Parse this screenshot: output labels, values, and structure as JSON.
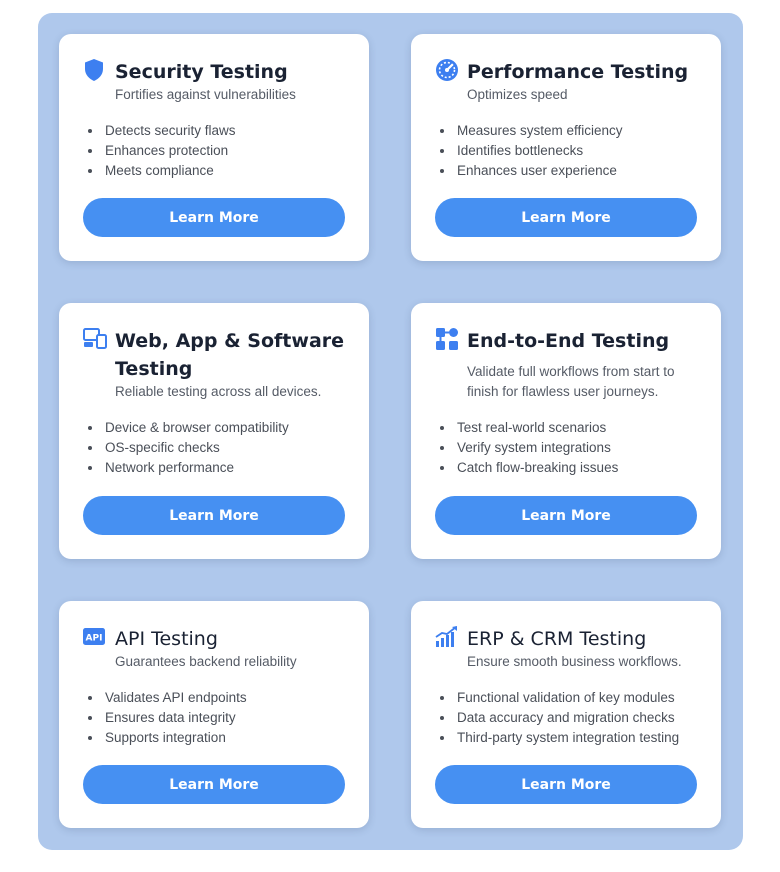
{
  "cards": [
    {
      "title": "Security Testing",
      "title_line2": "",
      "subtitle": "Fortifies against vulnerabilities",
      "icon": "shield-icon",
      "bullets": [
        "Detects security flaws",
        "Enhances protection",
        "Meets compliance"
      ],
      "button": "Learn More"
    },
    {
      "title": "Performance Testing",
      "title_line2": "",
      "subtitle": "Optimizes speed",
      "icon": "speedometer-icon",
      "bullets": [
        "Measures system efficiency",
        "Identifies bottlenecks",
        "Enhances user experience"
      ],
      "button": "Learn More"
    },
    {
      "title": "Web, App & Software",
      "title_line2": "Testing",
      "subtitle": "Reliable testing across all devices.",
      "icon": "devices-icon",
      "bullets": [
        "Device & browser compatibility",
        "OS-specific checks",
        "Network performance"
      ],
      "button": "Learn More"
    },
    {
      "title": "End-to-End Testing",
      "title_line2": "",
      "subtitle": "Validate full workflows from start to",
      "subtitle_line2": "finish for flawless user journeys.",
      "icon": "workflow-icon",
      "bullets": [
        "Test real-world scenarios",
        "Verify system integrations",
        "Catch flow-breaking issues"
      ],
      "button": "Learn More"
    },
    {
      "title": "API Testing",
      "title_line2": "",
      "subtitle": "Guarantees backend reliability",
      "icon": "api-icon",
      "icon_text": "API",
      "bullets": [
        "Validates API endpoints",
        "Ensures data integrity",
        "Supports integration"
      ],
      "button": "Learn More"
    },
    {
      "title": "ERP & CRM Testing",
      "title_line2": "",
      "subtitle": "Ensure smooth business workflows.",
      "icon": "growth-chart-icon",
      "bullets": [
        "Functional validation of key modules",
        "Data accuracy and migration checks",
        "Third-party system integration testing"
      ],
      "button": "Learn More"
    }
  ],
  "colors": {
    "panel_background": "#afc8ec",
    "accent": "#4690f2",
    "icon": "#3d7ff0",
    "heading": "#1a2233"
  }
}
